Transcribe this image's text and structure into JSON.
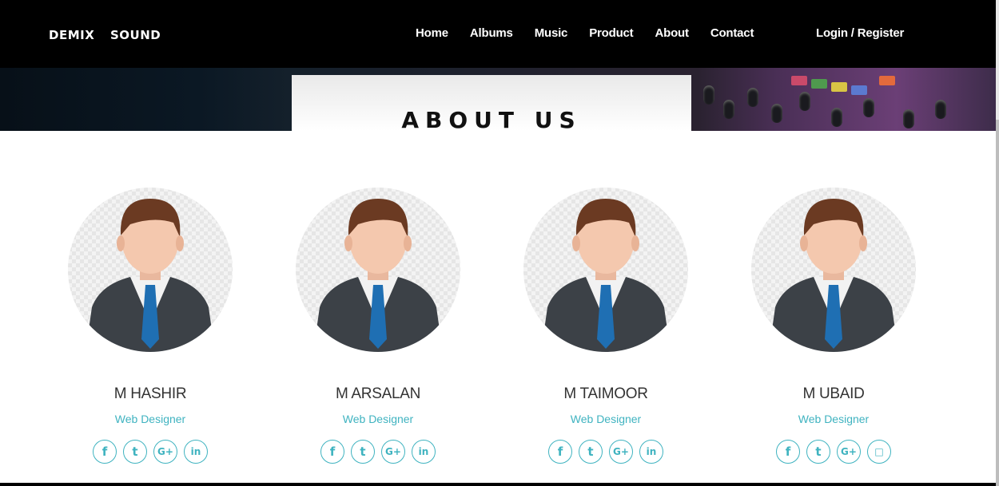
{
  "brand": "DEMIX SOUND",
  "nav": {
    "items": [
      "Home",
      "Albums",
      "Music",
      "Product",
      "About",
      "Contact"
    ],
    "login": "Login / Register"
  },
  "section": {
    "title": "ABOUT US"
  },
  "team": [
    {
      "name": "M HASHIR",
      "role": "Web Designer",
      "socials": [
        "f",
        "t",
        "G+",
        "in"
      ]
    },
    {
      "name": "M ARSALAN",
      "role": "Web Designer",
      "socials": [
        "f",
        "t",
        "G+",
        "in"
      ]
    },
    {
      "name": "M TAIMOOR",
      "role": "Web Designer",
      "socials": [
        "f",
        "t",
        "G+",
        "in"
      ]
    },
    {
      "name": "M UBAID",
      "role": "Web Designer",
      "socials": [
        "f",
        "t",
        "G+",
        "□"
      ]
    }
  ],
  "colors": {
    "accent": "#3fb3c0",
    "navbar": "#000000"
  }
}
